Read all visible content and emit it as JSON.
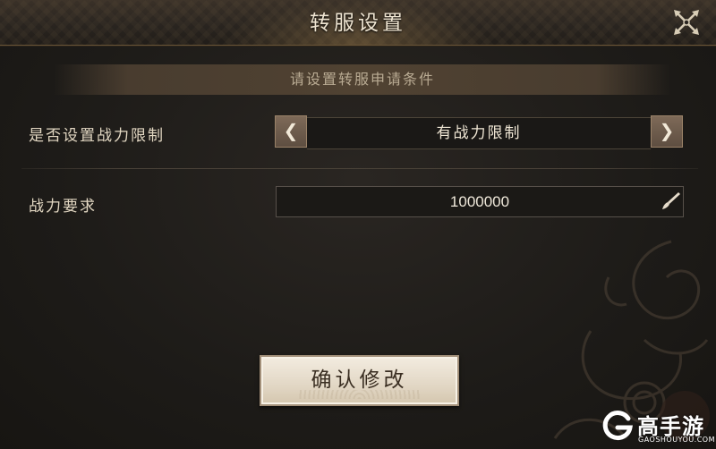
{
  "dialog": {
    "title": "转服设置",
    "subtitle": "请设置转服申请条件",
    "close_icon": "crossed-swords-close-icon"
  },
  "rows": {
    "power_limit": {
      "label": "是否设置战力限制",
      "selected_value": "有战力限制",
      "prev_icon": "chevron-left-icon",
      "next_icon": "chevron-right-icon",
      "prev_glyph": "❮",
      "next_glyph": "❯"
    },
    "power_requirement": {
      "label": "战力要求",
      "value": "1000000",
      "edit_icon": "brush-icon"
    }
  },
  "confirm_button": {
    "label": "确认修改"
  },
  "watermark": {
    "brand": "高手游",
    "url": "GAOSHOUYOU.COM"
  },
  "colors": {
    "background": "#1d1b18",
    "title_text": "#efe5d2",
    "label_text": "#e2d7c2",
    "arrow_button": "#6e5c4c",
    "confirm_button_face": "#e8dfcf",
    "confirm_button_text": "#3a2e22"
  }
}
